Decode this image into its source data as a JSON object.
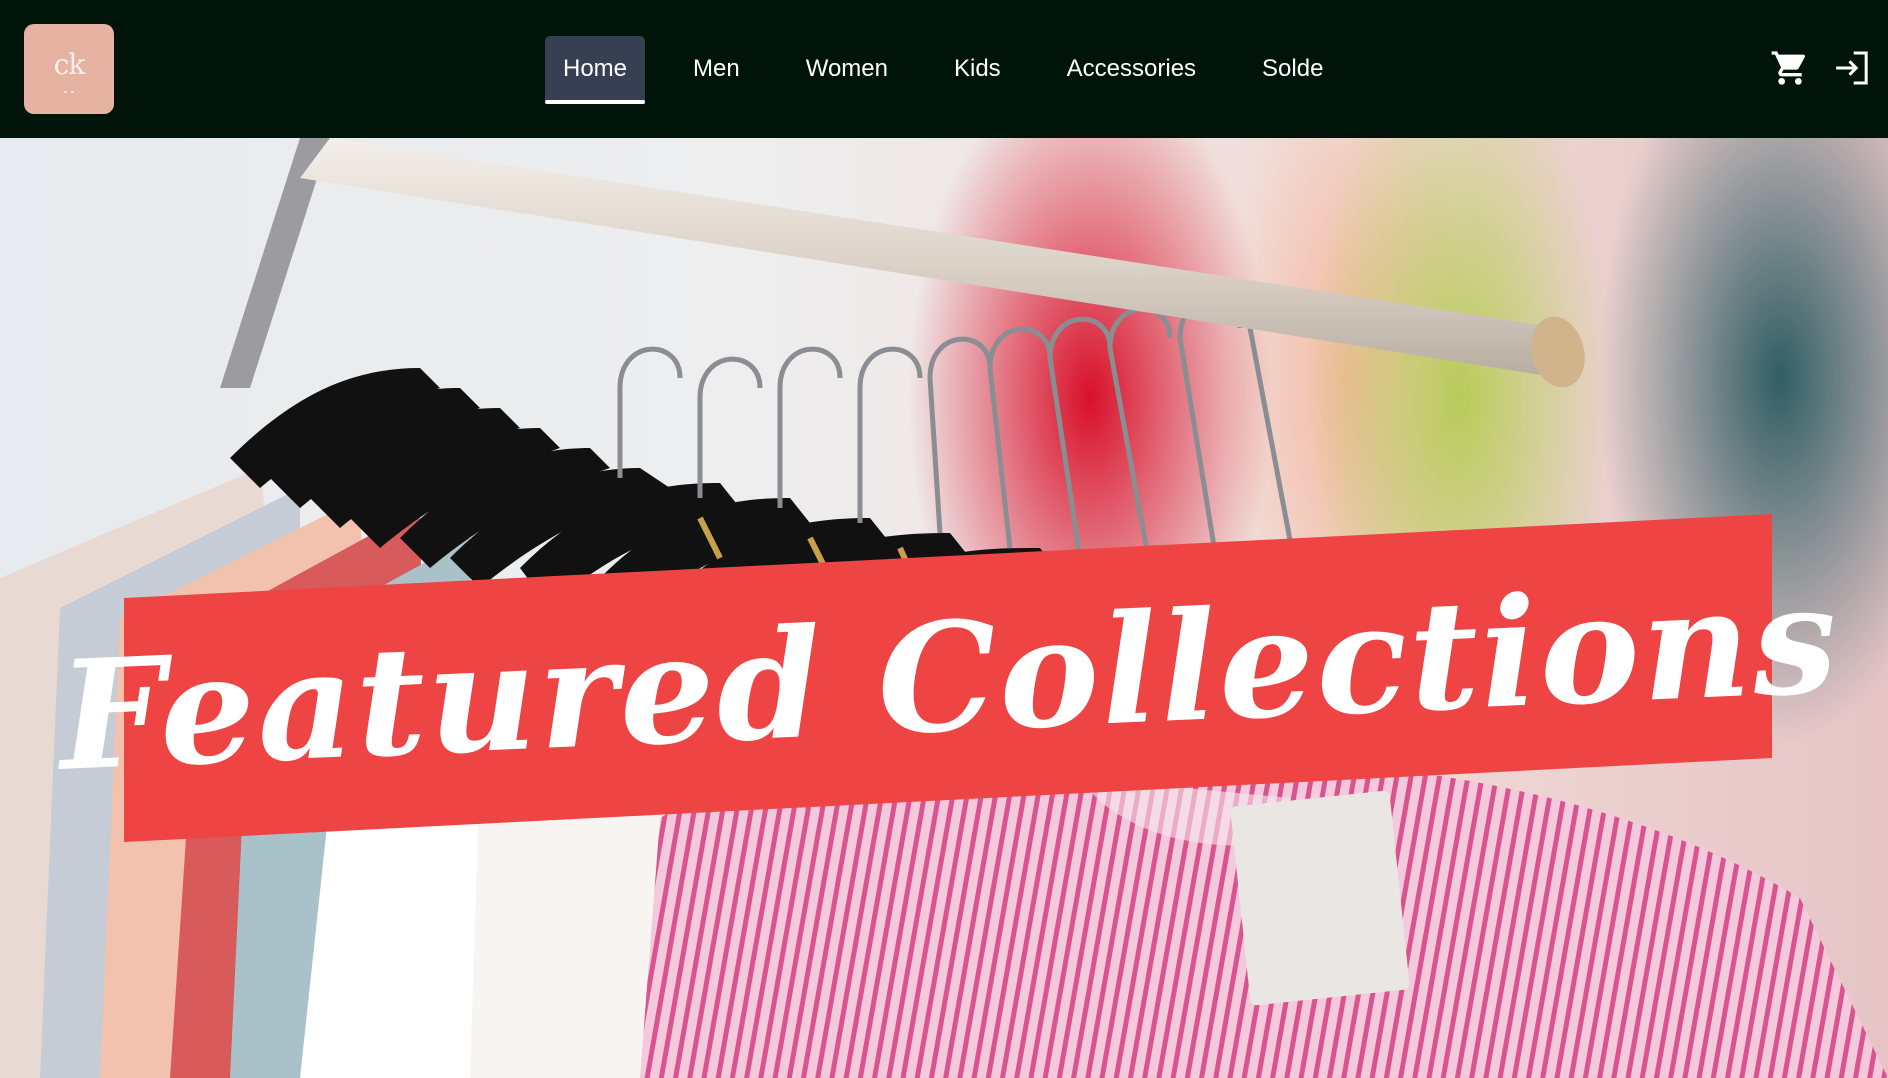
{
  "header": {
    "logo_text": "ck",
    "nav": [
      {
        "label": "Home",
        "active": true
      },
      {
        "label": "Men",
        "active": false
      },
      {
        "label": "Women",
        "active": false
      },
      {
        "label": "Kids",
        "active": false
      },
      {
        "label": "Accessories",
        "active": false
      },
      {
        "label": "Solde",
        "active": false
      }
    ],
    "icons": [
      "cart-icon",
      "login-icon"
    ]
  },
  "hero": {
    "title": "Featured Collections",
    "banner_color": "#ef4444",
    "image_subject": "clothing-rack"
  },
  "colors": {
    "navbar": "#00140a",
    "active_tab": "#373f52",
    "logo_bg": "#e6b3a2"
  }
}
